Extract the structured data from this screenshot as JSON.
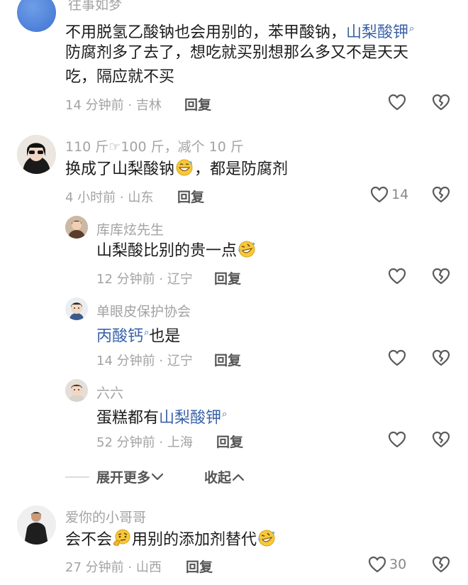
{
  "comments": [
    {
      "username": "往事如梦",
      "text_a": "不用脱氢乙酸钠也会用别的，苯甲酸钠，",
      "text_link": "山梨酸钾",
      "text_b": "防腐剂多了去了，想吃就买别想那么多又不是天天",
      "text_c": "吃，隔应就不买",
      "time": "14 分钟前",
      "location": "吉林",
      "reply_label": "回复",
      "likes": ""
    },
    {
      "username": "110 斤☞100 斤，减个 10 斤",
      "text_a": "换成了山梨酸钠",
      "text_b": "，都是防腐剂",
      "time": "4 小时前",
      "location": "山东",
      "reply_label": "回复",
      "likes": "14",
      "replies": [
        {
          "username": "库库炫先生",
          "text_a": "山梨酸比别的贵一点",
          "time": "12 分钟前",
          "location": "辽宁",
          "reply_label": "回复"
        },
        {
          "username": "单眼皮保护协会",
          "text_link": "丙酸钙",
          "text_b": "也是",
          "time": "14 分钟前",
          "location": "辽宁",
          "reply_label": "回复"
        },
        {
          "username": "六六",
          "text_a": "蛋糕都有",
          "text_link": "山梨酸钾",
          "time": "52 分钟前",
          "location": "上海",
          "reply_label": "回复"
        }
      ]
    },
    {
      "username": "爱你的小哥哥",
      "text_a": "会不会",
      "text_b": "用别的添加剂替代",
      "time": "27 分钟前",
      "location": "山西",
      "reply_label": "回复",
      "likes": "30"
    }
  ],
  "thread_controls": {
    "expand_label": "展开更多",
    "collapse_label": "收起"
  },
  "separator": "·",
  "colors": {
    "link": "#3b63a8",
    "meta": "#a3a3a3",
    "text": "#1c1c1c"
  },
  "icons": [
    "heart-outline-icon",
    "broken-heart-icon",
    "chevron-down-icon",
    "chevron-up-icon",
    "search-mark-icon"
  ]
}
